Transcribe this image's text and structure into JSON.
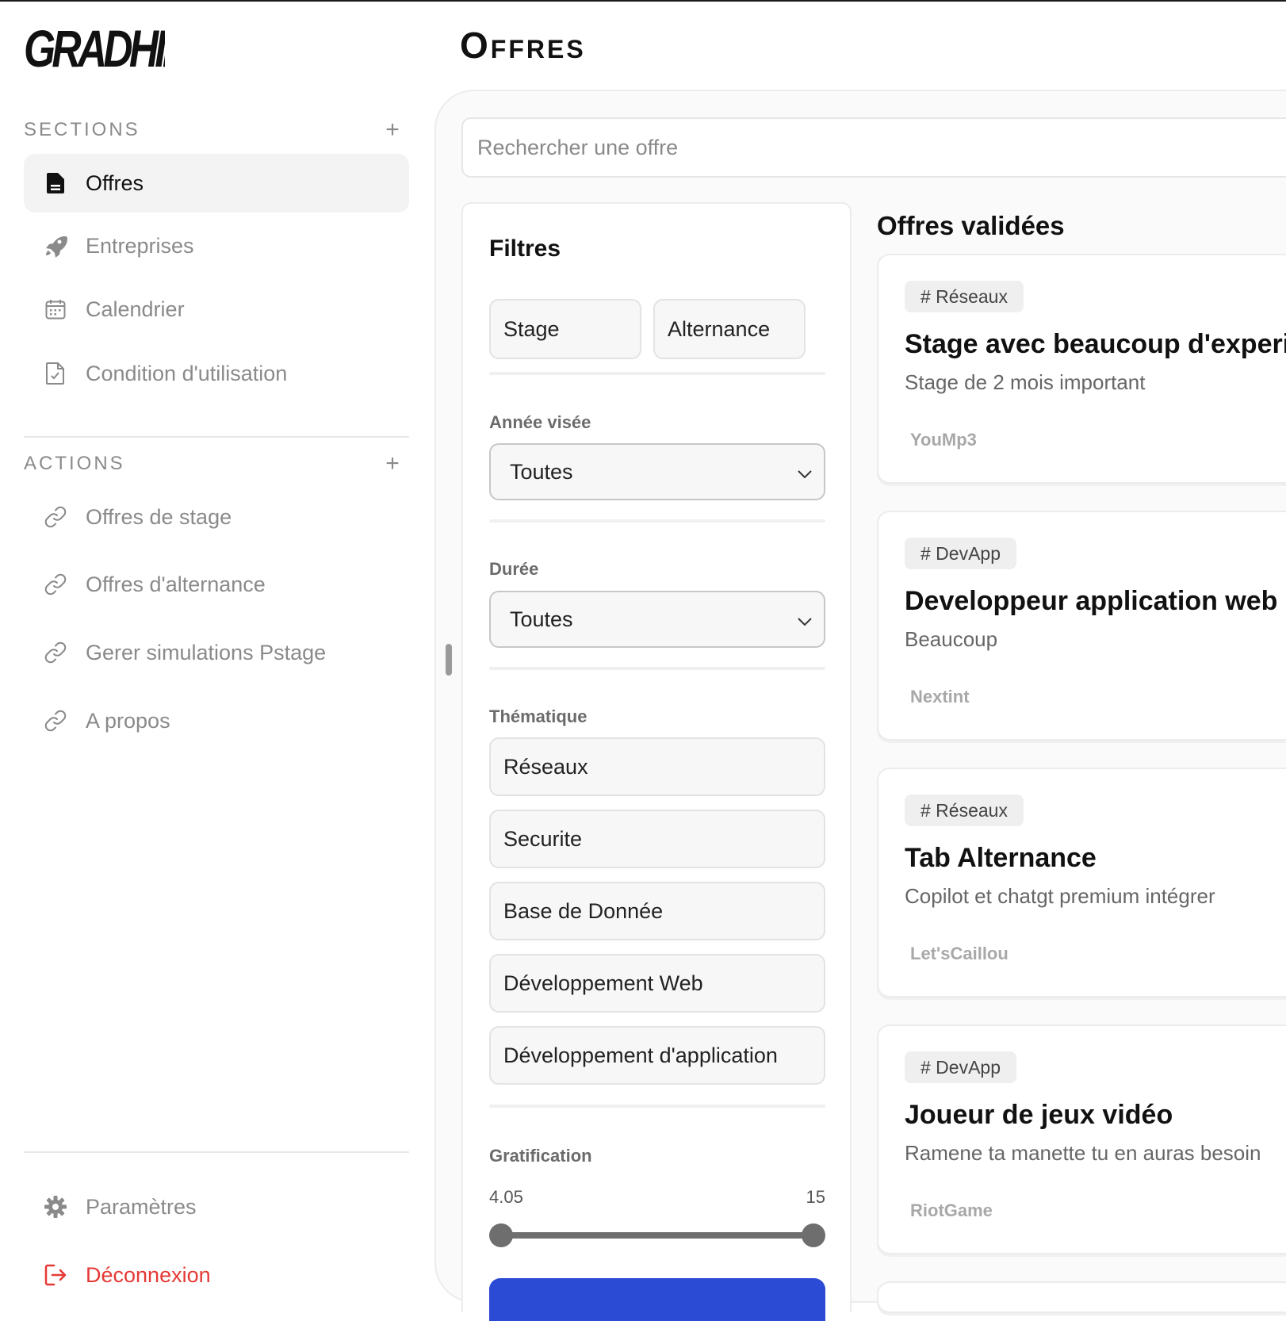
{
  "app": {
    "logo_text": "GRADHIRE"
  },
  "sidebar": {
    "sections_title": "SECTIONS",
    "sections_add": "+",
    "sections": [
      {
        "label": "Offres",
        "icon": "document-icon",
        "active": true
      },
      {
        "label": "Entreprises",
        "icon": "rocket-icon"
      },
      {
        "label": "Calendrier",
        "icon": "calendar-icon"
      },
      {
        "label": "Condition d'utilisation",
        "icon": "file-check-icon"
      }
    ],
    "actions_title": "ACTIONS",
    "actions_add": "+",
    "actions": [
      {
        "label": "Offres de stage",
        "icon": "link-icon"
      },
      {
        "label": "Offres d'alternance",
        "icon": "link-icon"
      },
      {
        "label": "Gerer simulations Pstage",
        "icon": "link-icon"
      },
      {
        "label": "A propos",
        "icon": "link-icon"
      }
    ],
    "settings_label": "Paramètres",
    "logout_label": "Déconnexion"
  },
  "main": {
    "title": "Offres",
    "search_placeholder": "Rechercher une offre",
    "filters": {
      "title": "Filtres",
      "type_options": [
        "Stage",
        "Alternance"
      ],
      "year_label": "Année visée",
      "year_value": "Toutes",
      "duration_label": "Durée",
      "duration_value": "Toutes",
      "theme_label": "Thématique",
      "themes": [
        "Réseaux",
        "Securite",
        "Base de Donnée",
        "Développement Web",
        "Développement d'application"
      ],
      "gratification_label": "Gratification",
      "gratification_min": "4.05",
      "gratification_max": "15"
    },
    "offers_title": "Offres validées",
    "offers": [
      {
        "tag": "# Réseaux",
        "title": "Stage avec beaucoup d'experience",
        "description": "Stage de 2 mois important",
        "company": "YouMp3"
      },
      {
        "tag": "# DevApp",
        "title": "Developpeur application web",
        "description": "Beaucoup",
        "company": "Nextint"
      },
      {
        "tag": "# Réseaux",
        "title": "Tab Alternance",
        "description": "Copilot et chatgt premium intégrer",
        "company": "Let'sCaillou"
      },
      {
        "tag": "# DevApp",
        "title": "Joueur de jeux vidéo",
        "description": "Ramene ta manette tu en auras besoin",
        "company": "RiotGame"
      }
    ]
  },
  "colors": {
    "accent": "#2c4bd5",
    "logout": "#e53935",
    "muted": "#8a8a8a"
  }
}
